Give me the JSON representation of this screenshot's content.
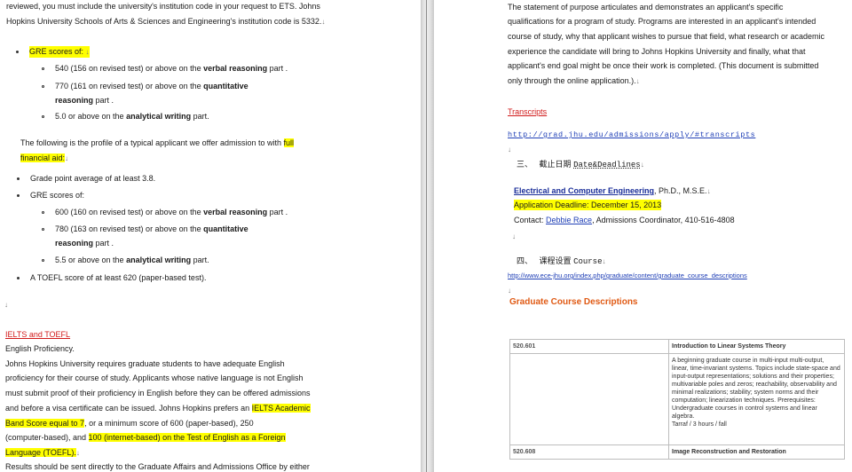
{
  "left": {
    "intro_line1": "reviewed, you must include the university's institution code in your request to ETS. Johns",
    "intro_line2": "Hopkins University Schools of Arts & Sciences and Engineering's institution code is 5332.",
    "gre1_head": "GRE scores of:",
    "gre1_verbal_pre": "540 (156 on revised test) or above on the ",
    "gre1_verbal_bold": "verbal reasoning",
    "gre1_verbal_post": " part .",
    "gre1_quant_pre": "770 (161 on revised test) or above on the ",
    "gre1_quant_bold1": "quantitative",
    "gre1_quant_bold2": "reasoning",
    "gre1_quant_post": " part .",
    "gre1_writing_pre": "5.0 or above on the ",
    "gre1_writing_bold": "analytical writing",
    "gre1_writing_post": " part.",
    "profile_pre": "The following is the profile of a typical applicant we offer admission to with ",
    "profile_hl1": "full",
    "profile_hl2": "financial aid:",
    "gpa": "Grade point average of at least 3.8.",
    "gre2_head": "GRE scores of:",
    "gre2_verbal_pre": "600 (160 on revised test) or above on the ",
    "gre2_verbal_bold": "verbal reasoning",
    "gre2_verbal_post": " part .",
    "gre2_quant_pre": "780 (163 on revised test) or above on the ",
    "gre2_quant_bold1": "quantitative",
    "gre2_quant_bold2": "reasoning",
    "gre2_quant_post": " part .",
    "gre2_writing_pre": "5.5 or above on the ",
    "gre2_writing_bold": "analytical writing",
    "gre2_writing_post": " part.",
    "toefl": "A TOEFL score of at least 620 (paper-based test).",
    "ielts_heading": "IELTS and TOEFL",
    "eng_prof": "English Proficiency.",
    "p1": "Johns Hopkins University requires graduate students to have adequate English",
    "p2": "proficiency for their course of study. Applicants whose native language is not English",
    "p3": "must submit proof of their proficiency in English before they can be offered admissions",
    "p4_pre": "and before a visa certificate can be issued. Johns Hopkins prefers an ",
    "p4_hl": "IELTS Academic",
    "p5_hl": "Band Score equal to 7",
    "p5_post": ", or a minimum score of 600 (paper-based), 250",
    "p6_pre": "(computer-based), and ",
    "p6_hl": "100 (internet-based) on the Test of English as a Foreign",
    "p7_hl": "Language (TOEFL).",
    "p8": "Results should be sent directly to the Graduate Affairs and Admissions Office by either"
  },
  "right": {
    "sp1": "The statement of purpose articulates and demonstrates an applicant's specific",
    "sp2": "qualifications for a program of study. Programs are interested in an applicant's intended",
    "sp3": "course of study, why that applicant wishes to pursue that field, what research or academic",
    "sp4": "experience the candidate will bring to Johns Hopkins University and finally, what that",
    "sp5": "applicant's end goal might be once their work is completed. (This document is submitted",
    "sp6": "only through the online application.).",
    "transcripts": "Transcripts",
    "transcripts_url": "http://grad.jhu.edu/admissions/apply/#transcripts",
    "sec3_num": "三、",
    "sec3_cn": "截止日期",
    "sec3_en": "Date&Deadlines",
    "dept_link": "Electrical and Computer Engineering",
    "dept_deg": ", Ph.D., M.S.E.",
    "deadline": "Application Deadline: December 15, 2013",
    "contact_pre": "Contact: ",
    "contact_name": "Debbie Race",
    "contact_post": ", Admissions Coordinator, 410-516-4808",
    "sec4_num": "四、",
    "sec4_cn": "课程设置",
    "sec4_en": "Course",
    "course_url": "http://www.ece-jhu.org/index.php/graduate/content/graduate_course_descriptions",
    "gcd": "Graduate Course Descriptions",
    "course1_num": "520.601",
    "course1_title": "Introduction to Linear Systems Theory",
    "course1_desc": "A beginning graduate course in multi-input multi-output, linear, time-invariant systems. Topics include state-space and input-output representations; solutions and their properties; multivariable poles and zeros; reachability, observability and minimal realizations; stability; system norms and their computation; linearization techniques. Prerequisites: Undergraduate courses in control systems and linear algebra.",
    "course1_credit": "Tarraf / 3 hours / fall",
    "course2_num": "520.608",
    "course2_title": "Image Reconstruction and Restoration"
  },
  "colors": {
    "highlight": "#ffff00",
    "heading_red": "#d11a1a",
    "link_blue": "#1f3fb6",
    "orange": "#e05a14"
  }
}
